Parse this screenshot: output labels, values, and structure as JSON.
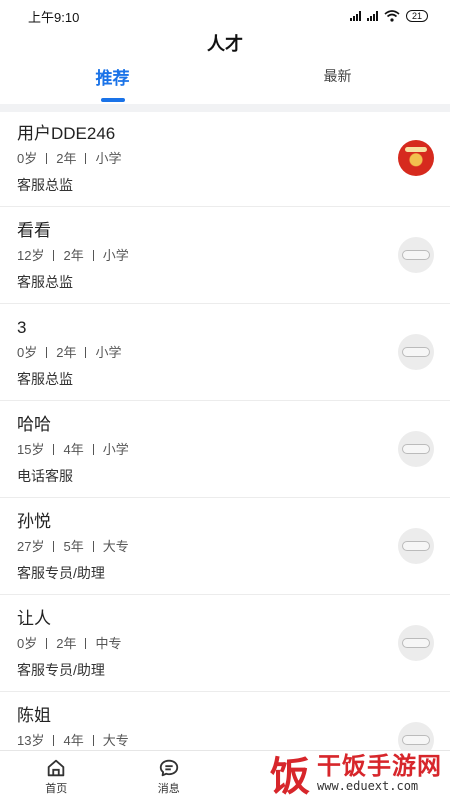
{
  "status_bar": {
    "time": "上午9:10",
    "battery": "21"
  },
  "header": {
    "title": "人才"
  },
  "tabs": [
    {
      "label": "推荐",
      "active": true
    },
    {
      "label": "最新",
      "active": false
    }
  ],
  "candidates": [
    {
      "name": "用户DDE246",
      "age": "0岁",
      "experience": "2年",
      "education": "小学",
      "position": "客服总监",
      "avatar": "red-envelope-avatar"
    },
    {
      "name": "看看",
      "age": "12岁",
      "experience": "2年",
      "education": "小学",
      "position": "客服总监",
      "avatar": "default-avatar"
    },
    {
      "name": "3",
      "age": "0岁",
      "experience": "2年",
      "education": "小学",
      "position": "客服总监",
      "avatar": "default-avatar"
    },
    {
      "name": "哈哈",
      "age": "15岁",
      "experience": "4年",
      "education": "小学",
      "position": "电话客服",
      "avatar": "default-avatar"
    },
    {
      "name": "孙悦",
      "age": "27岁",
      "experience": "5年",
      "education": "大专",
      "position": "客服专员/助理",
      "avatar": "default-avatar"
    },
    {
      "name": "让人",
      "age": "0岁",
      "experience": "2年",
      "education": "中专",
      "position": "客服专员/助理",
      "avatar": "default-avatar"
    },
    {
      "name": "陈姐",
      "age": "13岁",
      "experience": "4年",
      "education": "大专",
      "position": "",
      "avatar": "default-avatar"
    }
  ],
  "bottom_nav": [
    {
      "label": "首页",
      "icon": "home-icon"
    },
    {
      "label": "消息",
      "icon": "message-icon"
    }
  ],
  "watermark": {
    "logo_char": "饭",
    "title": "干饭手游网",
    "url": "www.eduext.com"
  },
  "colors": {
    "accent": "#1a73e8",
    "watermark_red": "#d7262b"
  }
}
